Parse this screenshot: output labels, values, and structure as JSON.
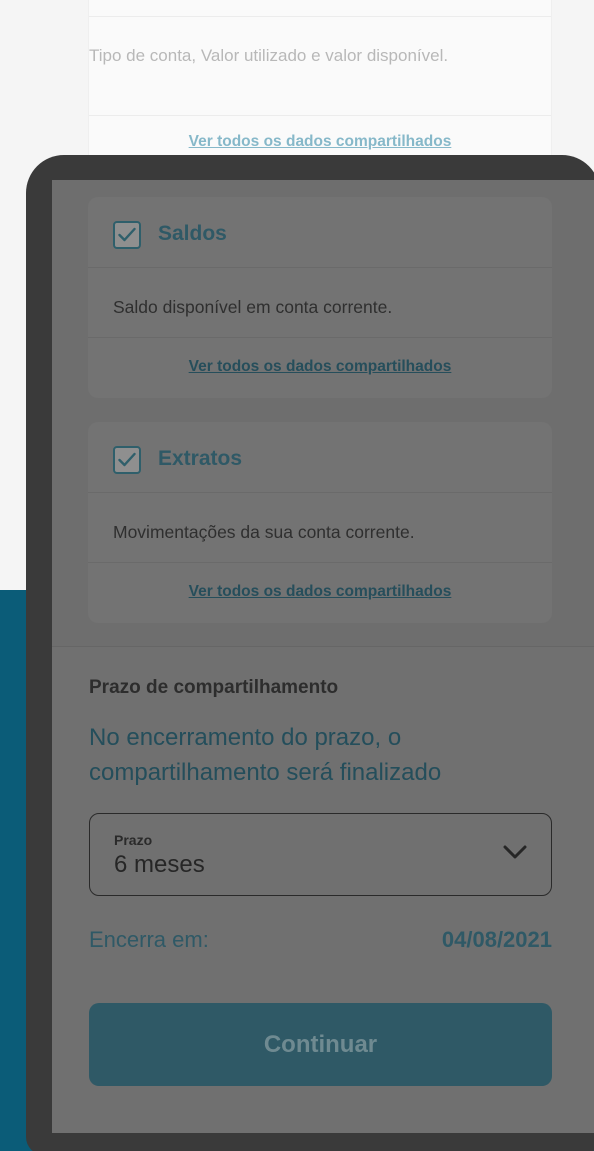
{
  "background_card": {
    "description": "Tipo de conta, Valor utilizado e valor disponível.",
    "link": "Ver todos os dados compartilhados"
  },
  "cards": [
    {
      "title": "Saldos",
      "checked": true,
      "description": "Saldo disponível em conta corrente.",
      "link": "Ver todos os dados compartilhados"
    },
    {
      "title": "Extratos",
      "checked": true,
      "description": "Movimentações da sua conta corrente.",
      "link": "Ver todos os dados compartilhados"
    }
  ],
  "prazo": {
    "section_label": "Prazo de compartilhamento",
    "info": "No encerramento do prazo, o compartilhamento será finalizado",
    "select_label": "Prazo",
    "select_value": "6 meses",
    "end_label": "Encerra em:",
    "end_date": "04/08/2021"
  },
  "continue_button": "Continuar",
  "colors": {
    "brand_teal": "#0b5c78",
    "button_bg": "#2f5966",
    "overlay_frame": "#3a3a3a"
  }
}
